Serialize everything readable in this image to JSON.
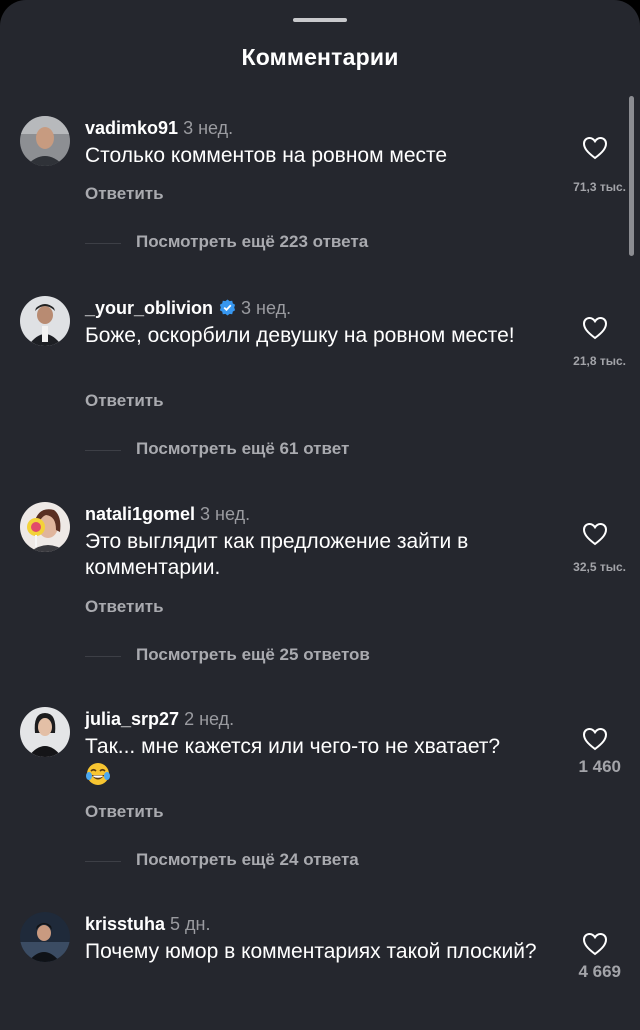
{
  "sheet": {
    "title": "Комментарии"
  },
  "comments": [
    {
      "username": "vadimko91",
      "time": "3 нед.",
      "text": "Столько комментов на ровном месте",
      "reply_label": "Ответить",
      "likes": "71,3 тыс.",
      "view_more": "Посмотреть ещё 223 ответа",
      "verified": false
    },
    {
      "username": "_your_oblivion",
      "time": "3 нед.",
      "text": "Боже, оскорбили девушку на ровном месте!",
      "reply_label": "Ответить",
      "likes": "21,8 тыс.",
      "view_more": "Посмотреть ещё 61 ответ",
      "verified": true
    },
    {
      "username": "natali1gomel",
      "time": "3 нед.",
      "text": "Это выглядит как предложение зайти в комментарии.",
      "reply_label": "Ответить",
      "likes": "32,5 тыс.",
      "view_more": "Посмотреть ещё 25 ответов",
      "verified": false
    },
    {
      "username": "julia_srp27",
      "time": "2 нед.",
      "text": "Так... мне кажется или чего-то не хватает?",
      "emoji": "tears-of-joy-emoji",
      "reply_label": "Ответить",
      "likes": "1 460",
      "view_more": "Посмотреть ещё 24 ответа",
      "verified": false
    },
    {
      "username": "krisstuha",
      "time": "5 дн.",
      "text": "Почему юмор в комментариях такой плоский?",
      "likes": "4 669",
      "verified": false
    }
  ],
  "icons": {
    "heart": "heart-outline-icon",
    "verified": "verified-badge-icon"
  },
  "colors": {
    "background": "#25272e",
    "text_primary": "#ffffff",
    "text_secondary": "#a9aaaf",
    "verified_blue": "#3797f0"
  }
}
